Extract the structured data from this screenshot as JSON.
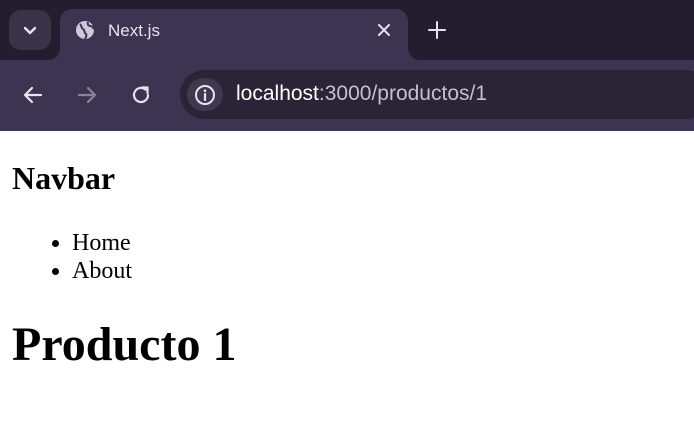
{
  "browser": {
    "tab": {
      "title": "Next.js",
      "favicon": "globe-icon",
      "close_icon": "close-icon"
    },
    "tab_search_icon": "chevron-down-icon",
    "new_tab_icon": "plus-icon",
    "toolbar": {
      "back_icon": "arrow-left-icon",
      "forward_icon": "arrow-right-icon",
      "reload_icon": "reload-icon",
      "info_icon": "info-icon"
    },
    "url": {
      "host": "localhost",
      "rest": ":3000/productos/1"
    },
    "colors": {
      "tabstrip": "#231d2f",
      "toolbar": "#3c3450",
      "omnibox": "#2a2436"
    }
  },
  "page": {
    "navbar_title": "Navbar",
    "nav_links": [
      "Home",
      "About"
    ],
    "product_title": "Producto 1"
  }
}
